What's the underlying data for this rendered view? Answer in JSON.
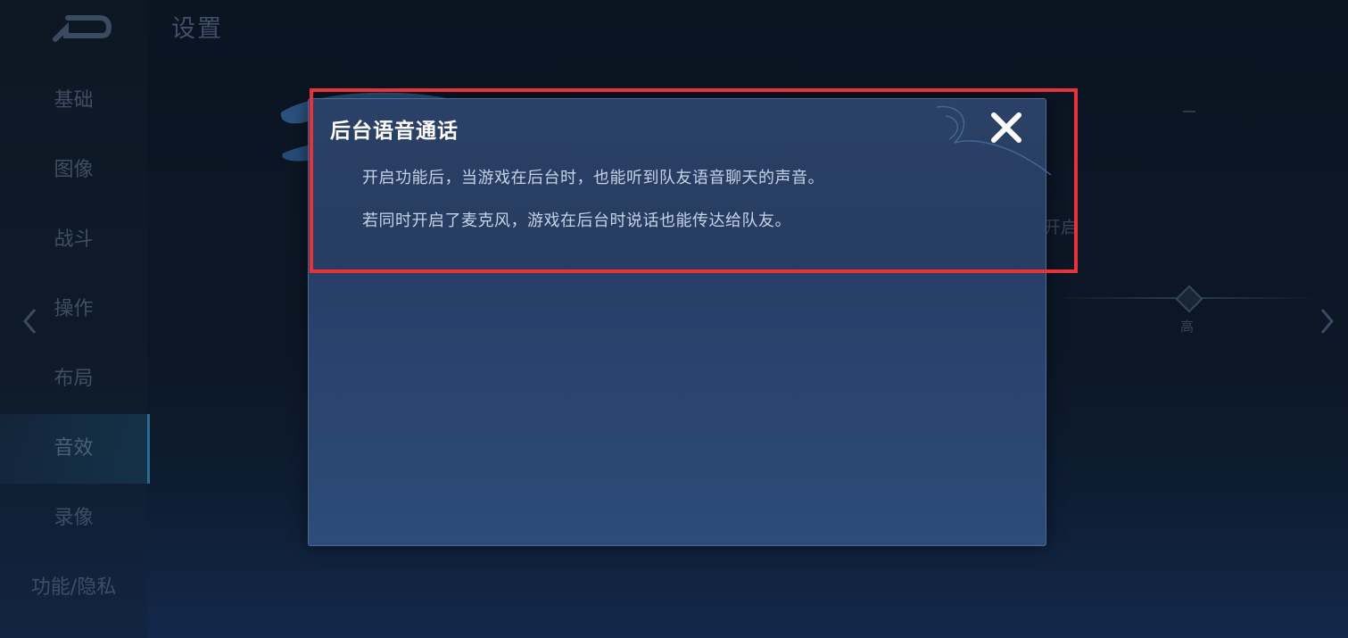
{
  "settings": {
    "title": "设置",
    "sidebar": {
      "items": [
        {
          "label": "基础"
        },
        {
          "label": "图像"
        },
        {
          "label": "战斗"
        },
        {
          "label": "操作"
        },
        {
          "label": "布局"
        },
        {
          "label": "音效"
        },
        {
          "label": "录像"
        },
        {
          "label": "功能/隐私"
        }
      ],
      "active": "音效"
    },
    "right_partial_text": "开启",
    "slider_label": "高"
  },
  "dialog": {
    "title": "后台语音通话",
    "lines": [
      "开启功能后，当游戏在后台时，也能听到队友语音聊天的声音。",
      "若同时开启了麦克风，游戏在后台时说话也能传达给队友。"
    ],
    "close_icon": "close-icon"
  },
  "colors": {
    "highlight": "#e8323a",
    "dialog_bg": "#27406a",
    "title_text": "#ffffff"
  }
}
